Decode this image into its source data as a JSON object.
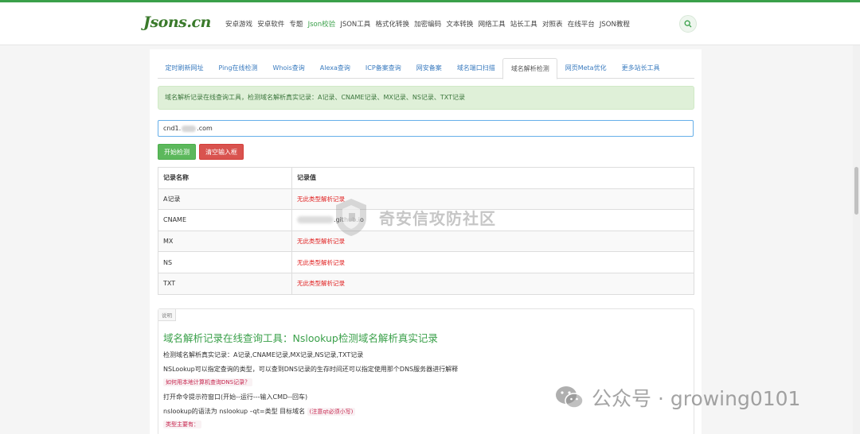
{
  "logo": "Jsons.cn",
  "nav": [
    "安卓游戏",
    "安卓软件",
    "专题",
    "Json校验",
    "JSON工具",
    "格式化转换",
    "加密编码",
    "文本转换",
    "网络工具",
    "站长工具",
    "对照表",
    "在线平台",
    "JSON教程"
  ],
  "nav_active_index": 3,
  "tabs": [
    "定时刷新网址",
    "Ping在线检测",
    "Whois查询",
    "Alexa查询",
    "ICP备案查询",
    "网安备案",
    "域名端口扫描",
    "域名解析检测",
    "网页Meta优化",
    "更多站长工具"
  ],
  "tab_active_index": 7,
  "alert": "域名解析记录在线查询工具，检测域名解析真实记录：A记录、CNAME记录、MX记录、NS记录、TXT记录",
  "input": {
    "prefix": "cnd1.",
    "suffix": ".com"
  },
  "buttons": {
    "start": "开始检测",
    "clear": "清空输入框"
  },
  "table": {
    "headers": [
      "记录名称",
      "记录值"
    ],
    "rows": [
      {
        "name": "A记录",
        "value": "无此类型解析记录",
        "error": true
      },
      {
        "name": "CNAME",
        "value": ".github.io",
        "error": false
      },
      {
        "name": "MX",
        "value": "无此类型解析记录",
        "error": true
      },
      {
        "name": "NS",
        "value": "无此类型解析记录",
        "error": true
      },
      {
        "name": "TXT",
        "value": "无此类型解析记录",
        "error": true
      }
    ]
  },
  "desc": {
    "tag": "说明",
    "title": "域名解析记录在线查询工具：Nslookup检测域名解析真实记录",
    "line1": "检测域名解析真实记录：A记录,CNAME记录,MX记录,NS记录,TXT记录",
    "line2": "NSLookup可以指定查询的类型，可以查到DNS记录的生存时间还可以指定使用那个DNS服务器进行解释",
    "code1": "如何用本地计算机查询DNS记录？",
    "line3": "打开命令提示符窗口(开始--运行---输入CMD--回车)",
    "line4": "nslookup的语法为 nslookup –qt=类型 目标域名",
    "code2": "(注意qt必须小写)",
    "code3": "类型主要有："
  },
  "watermark1": "奇安信攻防社区",
  "watermark2": "公众号 · growing0101",
  "colors": {
    "brand": "#3aa04a",
    "link": "#3a7bbf",
    "error": "#e02020",
    "alert_bg": "#dff0d8"
  }
}
